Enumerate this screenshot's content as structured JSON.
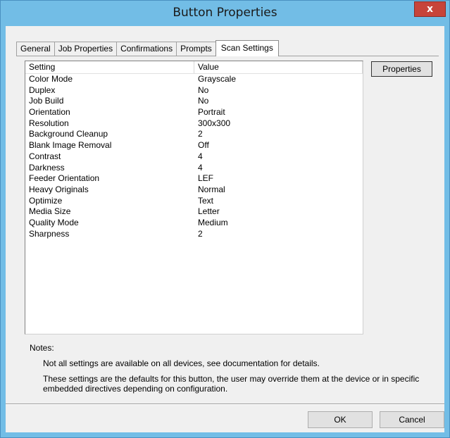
{
  "window": {
    "title": "Button Properties",
    "close_label": "x"
  },
  "tabs": [
    {
      "label": "General"
    },
    {
      "label": "Job Properties"
    },
    {
      "label": "Confirmations"
    },
    {
      "label": "Prompts"
    },
    {
      "label": "Scan Settings",
      "active": true
    }
  ],
  "settings_list": {
    "columns": [
      "Setting",
      "Value"
    ],
    "rows": [
      {
        "setting": "Color Mode",
        "value": "Grayscale"
      },
      {
        "setting": "Duplex",
        "value": "No"
      },
      {
        "setting": "Job Build",
        "value": "No"
      },
      {
        "setting": "Orientation",
        "value": "Portrait"
      },
      {
        "setting": "Resolution",
        "value": "300x300"
      },
      {
        "setting": "Background Cleanup",
        "value": "2"
      },
      {
        "setting": "Blank Image Removal",
        "value": "Off"
      },
      {
        "setting": "Contrast",
        "value": "4"
      },
      {
        "setting": "Darkness",
        "value": "4"
      },
      {
        "setting": "Feeder Orientation",
        "value": "LEF"
      },
      {
        "setting": "Heavy Originals",
        "value": "Normal"
      },
      {
        "setting": "Optimize",
        "value": "Text"
      },
      {
        "setting": "Media Size",
        "value": "Letter"
      },
      {
        "setting": "Quality Mode",
        "value": "Medium"
      },
      {
        "setting": "Sharpness",
        "value": "2"
      }
    ]
  },
  "buttons": {
    "properties": "Properties",
    "ok": "OK",
    "cancel": "Cancel"
  },
  "notes": {
    "label": "Notes:",
    "line1": "Not all settings are available on all devices, see documentation for details.",
    "line2": "These settings are the defaults for this button, the user may override them at the device or in specific embedded directives depending on configuration."
  },
  "colors": {
    "titlebar": "#72bde6",
    "close_button": "#c7443a",
    "dialog_background": "#f0f0f0"
  }
}
